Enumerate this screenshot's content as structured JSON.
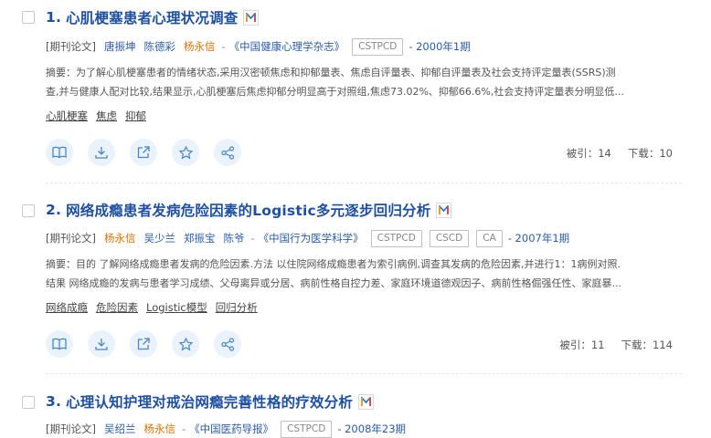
{
  "results": [
    {
      "number": "1.",
      "title": "心肌梗塞患者心理状况调查",
      "type": "[期刊论文]",
      "authors": [
        "唐振坤",
        "陈德彩",
        "杨永信"
      ],
      "journal_sep": "-",
      "journal": "《中国健康心理学杂志》",
      "tags": [
        "CSTPCD"
      ],
      "date": "- 2000年1期",
      "abstract_line1": "摘要：为了解心肌梗塞患者的情绪状态,采用汉密顿焦虑和抑郁量表、焦虑自评量表、抑郁自评量表及社会支持评定量表(SSRS)测",
      "abstract_line2": "查,并与健康人配对比较,结果显示,心肌梗塞后焦虑抑郁分明显高于对照组,焦虑73.02%、抑郁66.6%,社会支持评定量表分明显低...",
      "keywords": [
        "心肌梗塞",
        "焦虑",
        "抑郁"
      ],
      "cited_label": "被引：14",
      "download_label": "下载：10"
    },
    {
      "number": "2.",
      "title": "网络成瘾患者发病危险因素的Logistic多元逐步回归分析",
      "type": "[期刊论文]",
      "authors": [
        "杨永信",
        "吴少兰",
        "郑振宝",
        "陈爷"
      ],
      "journal_sep": "-",
      "journal": "《中国行为医学科学》",
      "tags": [
        "CSTPCD",
        "CSCD",
        "CA"
      ],
      "date": "- 2007年1期",
      "abstract_line1": "摘要：目的 了解网络成瘾患者发病的危险因素.方法 以住院网络成瘾患者为索引病例,调查其发病的危险因素,并进行1：1病例对照.",
      "abstract_line2": "结果 网络成瘾的发病与患者学习成绩、父母离异或分居、病前性格自控力差、家庭环境道德观因子、病前性格倔强任性、家庭暴...",
      "keywords": [
        "网络成瘾",
        "危险因素",
        "Logistic模型",
        "回归分析"
      ],
      "cited_label": "被引：11",
      "download_label": "下载：114"
    },
    {
      "number": "3.",
      "title": "心理认知护理对戒治网瘾完善性格的疗效分析",
      "type": "[期刊论文]",
      "authors": [
        "吴绍兰",
        "杨永信"
      ],
      "journal_sep": "-",
      "journal": "《中国医药导报》",
      "tags": [
        "CSTPCD"
      ],
      "date": "- 2008年23期"
    }
  ],
  "icons": [
    "read-icon",
    "download-icon",
    "open-icon",
    "favorite-icon",
    "share-icon",
    "m-badge-icon"
  ],
  "colors": {
    "title": "#1e50a2",
    "highlight_author": "#e07000",
    "link": "#2a5caa",
    "action_bg": "#eaf2fb"
  }
}
